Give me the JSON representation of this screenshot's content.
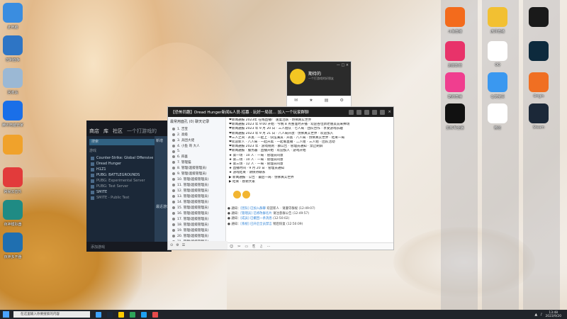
{
  "desktop": {
    "left_icons": [
      {
        "label": "此电脑",
        "color": "#3a8de0",
        "icon": "computer-icon"
      },
      {
        "label": "控制面板",
        "color": "#2e75c5",
        "icon": "control-panel-icon"
      },
      {
        "label": "回收站",
        "color": "#9bb8d4",
        "icon": "recycle-bin-icon"
      },
      {
        "label": "腾讯电脑管家",
        "color": "#1a6fe8",
        "icon": "shield-icon"
      },
      {
        "label": "",
        "color": "#f0a22b",
        "icon": "pinwheel-icon"
      },
      {
        "label": "网易云音乐",
        "color": "#e23b3b",
        "icon": "netease-music-icon"
      },
      {
        "label": "夜神模拟器",
        "color": "#1f8b84",
        "icon": "nox-icon"
      },
      {
        "label": "夜神多开器",
        "color": "#1f6fb0",
        "icon": "nox-multi-icon"
      }
    ],
    "right_col1": [
      {
        "label": "斗鱼直播",
        "color": "#f36b1c",
        "icon": "douyu-icon"
      },
      {
        "label": "迅雷影音",
        "color": "#e8336a",
        "icon": "video-player-icon"
      },
      {
        "label": "酷狗直播",
        "color": "#f03e8f",
        "icon": "kugou-live-icon"
      },
      {
        "label": "剪映专业版",
        "color": "#111111",
        "icon": "capcut-icon"
      }
    ],
    "right_col2": [
      {
        "label": "虎牙直播",
        "color": "#f2c032",
        "icon": "huya-icon"
      },
      {
        "label": "QQ",
        "color": "#ffffff",
        "icon": "qq-icon"
      },
      {
        "label": "Ｑ宠宝贝",
        "color": "#3a98f0",
        "icon": "qq-pet-icon"
      },
      {
        "label": "微信",
        "color": "#ffffff",
        "icon": "wechat-icon"
      }
    ],
    "right_col3": [
      {
        "label": "",
        "color": "#1a1a1a",
        "icon": "game-icon"
      },
      {
        "label": "",
        "color": "#0d2a3d",
        "icon": "power-icon"
      },
      {
        "label": "Origin",
        "color": "#f06f22",
        "icon": "origin-icon"
      },
      {
        "label": "Steam",
        "color": "#1b2838",
        "icon": "steam-icon"
      }
    ]
  },
  "steam": {
    "nav": [
      "商店",
      "库",
      "社区",
      "一个打游戏的"
    ],
    "search_placeholder": "搜索",
    "games_head": "游戏",
    "games": [
      {
        "name": "Counter-Strike: Global Offensive",
        "dim": false
      },
      {
        "name": "Dread Hunger",
        "dim": false
      },
      {
        "name": "H1Z1",
        "dim": false
      },
      {
        "name": "PUBG: BATTLEGROUNDS",
        "dim": false
      },
      {
        "name": "PUBG: Experimental Server",
        "dim": true
      },
      {
        "name": "PUBG: Test Server",
        "dim": true
      },
      {
        "name": "SMITE",
        "dim": false
      },
      {
        "name": "SMITE - Public Test",
        "dim": true
      }
    ],
    "side_texts": [
      "新增",
      "最近游戏"
    ],
    "bottom": "添加游戏"
  },
  "qq_mini": {
    "name": "期待的",
    "signature": "一个打游戏的好朋友",
    "controls": "— □ ×"
  },
  "chat": {
    "title": "【恐怖同趣】Dread Hunger新闻&人员·招募 · 玩好一局就… 加入一个玩家群聊",
    "left_header": "最常用面孔 (0) 聊天记录",
    "left_rows": [
      "1.  吉宝",
      "2.  高级",
      "3.  兵团大佬",
      "4.  小鱼 哥 大人",
      "5.",
      "6.  四喜",
      "7.  管理猫",
      "8.  管理(超级管理员)",
      "9.  管理(超级管理员)",
      "10. 管理(超级管理员)",
      "11. 管理(超级管理员)",
      "12. 管理(超级管理员)",
      "13. 管理(超级管理员)",
      "14. 管理(超级管理员)",
      "15. 管理(超级管理员)",
      "16. 管理(超级管理员)",
      "17. 管理(超级管理员)",
      "18. 管理(超级管理员)",
      "19. 管理(超级管理员)",
      "20. 管理(超级管理员)",
      "21. 管理(超级管理员)",
      "22. 管理(超级管理员)",
      "23. 管理(超级管理员)",
      "24. 管理(超级管理员)"
    ],
    "messages": [
      "❤新闻通报 2023年 在线直播！ 速度活跃 · 仿佛真实世界",
      "❤新闻通报 2023 年 9:00 开始 · 今晚 8 点整准时开播 · 欢迎各位新老朋友前来捧场",
      "❤新闻通报 2023 年 9 月 20 日 · 三人组队 · 七人局 · 团队合作 · 享受游戏乐趣",
      "❤新闻通报 2023 年 9 月 21 日 · 八人局开放 · 仿佛真实世界 · 欢迎加入",
      "❤三人之间 · 开黑 · 一起上 · 队伍满员 · 开黑 · 八人局 · 仿佛真实世界 · 结束一局",
      "❤欢迎新人 · 八人局 · 一起开黑 · 一起看直播 · 二人组 · 三人组 · 团队活动",
      "❤新闻通报 2023 年 · 游戏规则 · 群公告 · 管理员通知 · 禁止刷屏",
      "❤新闻通报 · 服务器 · 直播开始 · 欢迎加入 · 游戏开始",
      "★ 第一场 · 10 人 · 一局 · 管理员同意",
      "★ 第二场 · 10 人 · 一局 · 管理员同意",
      "★ 第三场 · 12 人 · 一局 · 管理员同意",
      "★ 直播时间 · 9 月 20 日 · 管理员通知",
      "★ 游戏结束 · 请保持联系",
      "▶ 新闻通报 · 公告 · 最后一局 · 仿佛真实世界",
      "▶ 结束 · 感谢大家"
    ],
    "log": [
      {
        "pre": "通知",
        "link": "[团队] 已加入群聊",
        "post": "欢迎新人 · 请遵守群规 (12:49:07)"
      },
      {
        "pre": "通知",
        "link": "[管理员] 已修改群名片",
        "post": "请注意群公告 (12:49:57)"
      },
      {
        "pre": "通知",
        "link": "[成员] 已撤回一条消息",
        "post": "(12:50:02)"
      },
      {
        "pre": "通知",
        "link": "[系统] 已开启全员禁言",
        "post": "稍后恢复 (12:50:09)"
      }
    ],
    "input_tools": [
      "☺",
      "✂",
      "▭",
      "⎘",
      "♫",
      "⋯"
    ],
    "left_tools": [
      "⊙",
      "⚙",
      "☰"
    ]
  },
  "taskbar": {
    "search_placeholder": "在这里输入你要搜索的内容",
    "apps": [
      {
        "color": "#3ea3ff",
        "icon": "task-view-icon"
      },
      {
        "color": "#1b2838",
        "icon": "steam-taskbar-icon"
      },
      {
        "color": "#ffcc00",
        "icon": "folder-icon"
      },
      {
        "color": "#2ea55a",
        "icon": "wechat-taskbar-icon"
      },
      {
        "color": "#1ea1f2",
        "icon": "qq-taskbar-icon"
      },
      {
        "color": "#e54b4b",
        "icon": "netease-taskbar-icon"
      }
    ],
    "time": "13:48",
    "date": "2023/9/20"
  }
}
